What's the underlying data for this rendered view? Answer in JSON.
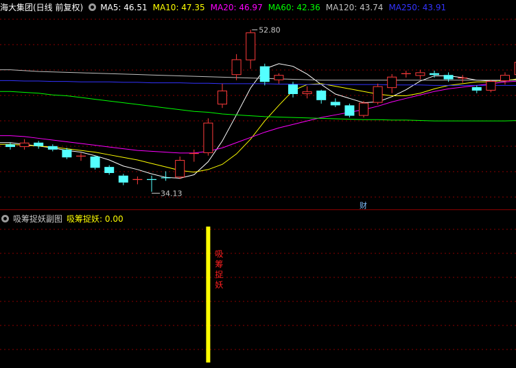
{
  "header": {
    "stock_title": "海大集团(日线 前复权)",
    "ma_labels": [
      {
        "text": "MA5: 46.51",
        "color": "#ffffff"
      },
      {
        "text": "MA10: 47.35",
        "color": "#ffff00"
      },
      {
        "text": "MA20: 46.97",
        "color": "#ff00ff"
      },
      {
        "text": "MA60: 42.36",
        "color": "#00ff00"
      },
      {
        "text": "MA120: 43.74",
        "color": "#c0c0c0"
      },
      {
        "text": "MA250: 43.91",
        "color": "#3333ff"
      }
    ]
  },
  "sub_header": {
    "indicator_name": "吸筹捉妖副图",
    "value_label": "吸筹捉妖: 0.00",
    "value_color": "#ffff00"
  },
  "colors": {
    "up": "#ff3b3b",
    "down": "#54ffff",
    "grid": "#8b0000",
    "signal_bar": "#ffff00",
    "signal_text": "#ff2020"
  },
  "chart_data": [
    {
      "type": "candlestick",
      "title": "海大集团(日线 前复权)",
      "ylim": [
        32.5,
        54.5
      ],
      "candles": [
        {
          "o": 39.6,
          "c": 39.3,
          "h": 39.8,
          "l": 39.0
        },
        {
          "o": 39.3,
          "c": 39.8,
          "h": 40.2,
          "l": 39.0
        },
        {
          "o": 39.8,
          "c": 39.4,
          "h": 40.0,
          "l": 39.1
        },
        {
          "o": 39.4,
          "c": 39.0,
          "h": 39.6,
          "l": 38.8
        },
        {
          "o": 39.0,
          "c": 38.1,
          "h": 39.2,
          "l": 37.9
        },
        {
          "o": 38.2,
          "c": 38.3,
          "h": 38.6,
          "l": 37.7
        },
        {
          "o": 38.2,
          "c": 36.9,
          "h": 38.3,
          "l": 36.7
        },
        {
          "o": 37.0,
          "c": 36.3,
          "h": 37.2,
          "l": 36.1
        },
        {
          "o": 36.0,
          "c": 35.2,
          "h": 36.2,
          "l": 34.9
        },
        {
          "o": 35.5,
          "c": 35.6,
          "h": 35.9,
          "l": 35.0
        },
        {
          "o": 35.6,
          "c": 35.5,
          "h": 36.0,
          "l": 34.13
        },
        {
          "o": 35.8,
          "c": 35.7,
          "h": 36.5,
          "l": 35.4
        },
        {
          "o": 35.8,
          "c": 37.8,
          "h": 38.2,
          "l": 35.6
        },
        {
          "o": 38.5,
          "c": 38.6,
          "h": 39.0,
          "l": 37.6
        },
        {
          "o": 38.6,
          "c": 42.1,
          "h": 42.6,
          "l": 38.3
        },
        {
          "o": 44.2,
          "c": 45.8,
          "h": 46.6,
          "l": 43.8
        },
        {
          "o": 47.6,
          "c": 49.4,
          "h": 50.0,
          "l": 47.0
        },
        {
          "o": 49.3,
          "c": 52.5,
          "h": 52.8,
          "l": 48.3
        },
        {
          "o": 48.6,
          "c": 46.8,
          "h": 48.9,
          "l": 46.4
        },
        {
          "o": 47.0,
          "c": 47.6,
          "h": 47.8,
          "l": 46.6
        },
        {
          "o": 46.5,
          "c": 45.4,
          "h": 46.8,
          "l": 45.0
        },
        {
          "o": 45.4,
          "c": 45.7,
          "h": 46.3,
          "l": 44.9
        },
        {
          "o": 45.8,
          "c": 44.7,
          "h": 45.9,
          "l": 44.3
        },
        {
          "o": 44.5,
          "c": 44.1,
          "h": 44.9,
          "l": 43.9
        },
        {
          "o": 44.1,
          "c": 42.9,
          "h": 44.3,
          "l": 42.7
        },
        {
          "o": 42.9,
          "c": 44.4,
          "h": 44.6,
          "l": 42.7
        },
        {
          "o": 44.4,
          "c": 46.3,
          "h": 46.6,
          "l": 44.2
        },
        {
          "o": 46.1,
          "c": 47.4,
          "h": 47.7,
          "l": 45.5
        },
        {
          "o": 47.7,
          "c": 47.8,
          "h": 48.1,
          "l": 47.3
        },
        {
          "o": 47.5,
          "c": 47.9,
          "h": 48.2,
          "l": 47.1
        },
        {
          "o": 47.8,
          "c": 47.6,
          "h": 48.1,
          "l": 47.3
        },
        {
          "o": 47.6,
          "c": 47.1,
          "h": 47.9,
          "l": 46.8
        },
        {
          "o": 47.2,
          "c": 47.3,
          "h": 47.6,
          "l": 46.7
        },
        {
          "o": 46.2,
          "c": 45.8,
          "h": 46.4,
          "l": 45.5
        },
        {
          "o": 45.8,
          "c": 46.9,
          "h": 47.0,
          "l": 45.6
        },
        {
          "o": 46.9,
          "c": 47.6,
          "h": 47.9,
          "l": 46.5
        },
        {
          "o": 47.6,
          "c": 49.1,
          "h": 49.4,
          "l": 47.4
        },
        {
          "o": 48.6,
          "c": 50.8,
          "h": 51.1,
          "l": 48.4
        }
      ],
      "ma_series": [
        {
          "name": "MA5",
          "color": "#ffffff",
          "values": [
            39.8,
            39.6,
            39.4,
            39.2,
            38.9,
            38.7,
            38.3,
            37.8,
            37.1,
            36.7,
            36.2,
            35.8,
            35.7,
            36.1,
            37.6,
            40.0,
            43.0,
            46.1,
            48.3,
            48.9,
            48.6,
            47.7,
            46.5,
            45.4,
            44.9,
            44.4,
            44.5,
            45.1,
            45.9,
            46.9,
            47.5,
            47.5,
            47.3,
            47.0,
            46.9,
            46.9,
            47.2,
            48.0
          ]
        },
        {
          "name": "MA10",
          "color": "#ffff00",
          "values": [
            39.6,
            39.5,
            39.4,
            39.3,
            39.1,
            38.9,
            38.7,
            38.4,
            38.1,
            37.8,
            37.4,
            37.0,
            36.6,
            36.4,
            36.7,
            37.3,
            38.5,
            40.2,
            42.3,
            44.1,
            45.8,
            46.5,
            46.6,
            46.3,
            46.0,
            45.7,
            45.4,
            45.2,
            45.2,
            45.5,
            46.0,
            46.4,
            46.6,
            46.8,
            46.8,
            47.0,
            47.1,
            47.3
          ]
        },
        {
          "name": "MA20",
          "color": "#ff00ff",
          "values": [
            40.6,
            40.5,
            40.3,
            40.1,
            39.9,
            39.7,
            39.5,
            39.3,
            39.1,
            38.9,
            38.8,
            38.7,
            38.6,
            38.6,
            38.8,
            39.2,
            39.8,
            40.4,
            41.0,
            41.5,
            41.9,
            42.3,
            42.7,
            43.0,
            43.3,
            43.6,
            44.0,
            44.5,
            44.9,
            45.3,
            45.7,
            46.0,
            46.2,
            46.4,
            46.6,
            46.8,
            46.9,
            47.0
          ]
        },
        {
          "name": "MA60",
          "color": "#00ff00",
          "values": [
            45.7,
            45.6,
            45.5,
            45.3,
            45.2,
            45.0,
            44.8,
            44.6,
            44.4,
            44.2,
            44.0,
            43.8,
            43.6,
            43.4,
            43.3,
            43.1,
            43.0,
            42.9,
            42.8,
            42.75,
            42.7,
            42.65,
            42.6,
            42.55,
            42.5,
            42.45,
            42.45,
            42.4,
            42.4,
            42.35,
            42.3,
            42.3,
            42.3,
            42.3,
            42.3,
            42.3,
            42.35,
            42.4
          ]
        },
        {
          "name": "MA120",
          "color": "#c0c0c0",
          "values": [
            48.2,
            48.1,
            48.0,
            47.95,
            47.9,
            47.85,
            47.8,
            47.75,
            47.7,
            47.65,
            47.6,
            47.55,
            47.5,
            47.45,
            47.4,
            47.35,
            47.3,
            47.25,
            47.2,
            47.15,
            47.1,
            47.05,
            47.0,
            47.0,
            47.0,
            47.0,
            47.0,
            47.0,
            47.0,
            47.0,
            47.0,
            47.0,
            47.0,
            47.0,
            47.0,
            47.0,
            47.0,
            47.0
          ]
        },
        {
          "name": "MA250",
          "color": "#3333ff",
          "values": [
            46.95,
            46.9,
            46.9,
            46.85,
            46.85,
            46.8,
            46.8,
            46.8,
            46.75,
            46.75,
            46.7,
            46.7,
            46.7,
            46.65,
            46.65,
            46.6,
            46.6,
            46.6,
            46.6,
            46.55,
            46.55,
            46.5,
            46.5,
            46.5,
            46.5,
            46.5,
            46.5,
            46.45,
            46.45,
            46.45,
            46.4,
            46.4,
            46.4,
            46.4,
            46.4,
            46.4,
            46.4,
            46.4
          ]
        }
      ],
      "annotations": [
        {
          "text": "52.80",
          "candle_index": 17,
          "value": 52.8
        },
        {
          "text": "34.13",
          "candle_index": 10,
          "value": 34.13
        },
        {
          "text": "财",
          "candle_index": 25
        }
      ]
    },
    {
      "type": "bar",
      "title": "吸筹捉妖副图",
      "series": [
        {
          "name": "吸筹捉妖",
          "signal_candle_index": 14,
          "signal_text": "吸筹捉妖"
        }
      ]
    }
  ]
}
